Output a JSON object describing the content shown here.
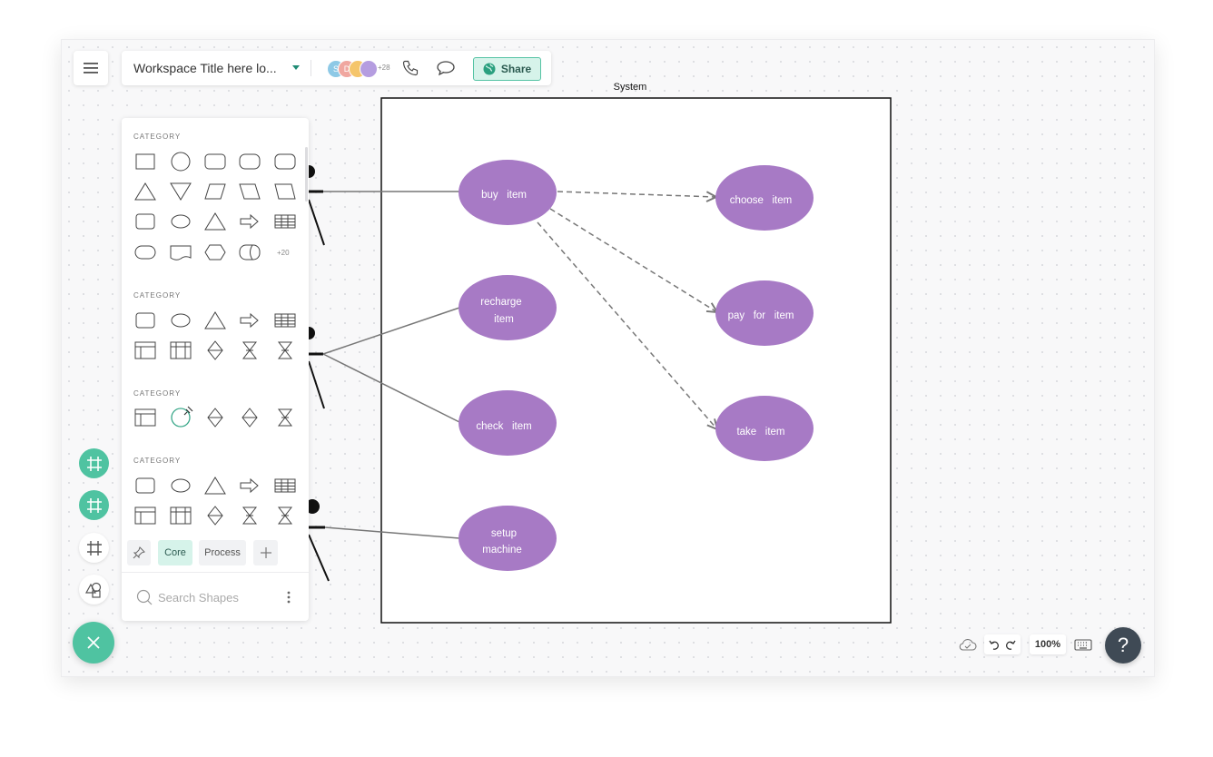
{
  "topbar": {
    "workspace_title": "Workspace Title here lo...",
    "avatars": [
      {
        "initial": "S",
        "color": "#8ec9e6"
      },
      {
        "initial": "D",
        "color": "#f0a7a0"
      },
      {
        "initial": "",
        "color": "#f5c56b"
      },
      {
        "initial": "",
        "color": "#b59de0"
      }
    ],
    "avatar_more": "+28",
    "share_label": "Share"
  },
  "shapes_panel": {
    "categories": [
      "CATEGORY",
      "CATEGORY",
      "CATEGORY",
      "CATEGORY"
    ],
    "more_shapes": "+20",
    "tabs": [
      "Core",
      "Process"
    ],
    "search_placeholder": "Search Shapes"
  },
  "diagram": {
    "system_label": "System",
    "use_cases": [
      {
        "label": "buy   item"
      },
      {
        "label": "choose   item"
      },
      {
        "label": "recharge",
        "label2": "item"
      },
      {
        "label": "pay   for   item"
      },
      {
        "label": "check   item"
      },
      {
        "label": "take   item"
      },
      {
        "label": "setup",
        "label2": "machine"
      }
    ],
    "ellipse_color": "#a77ac5"
  },
  "bottom": {
    "zoom": "100%",
    "help": "?"
  },
  "colors": {
    "accent": "#4fc3a1",
    "share_bg": "#d6f3ea"
  }
}
